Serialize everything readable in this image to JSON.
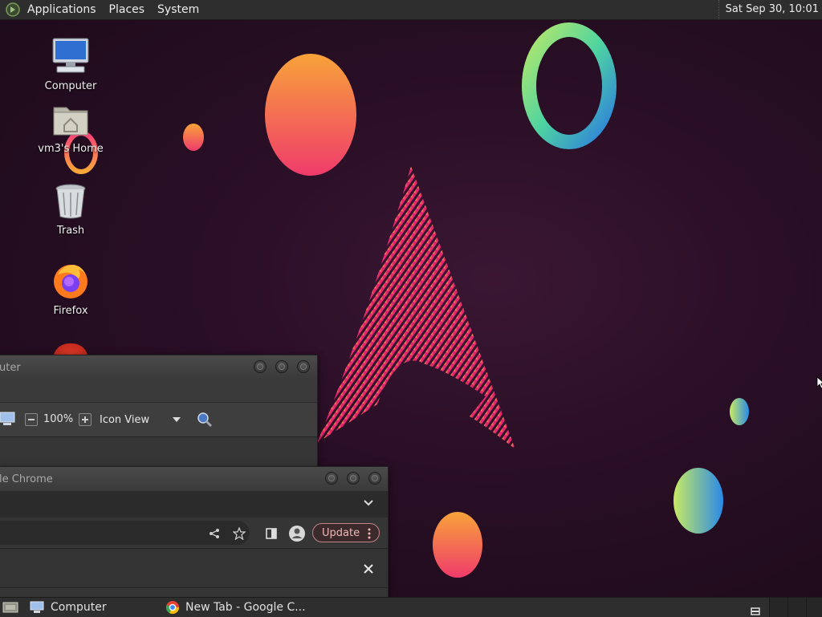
{
  "top_panel": {
    "menus": [
      "Applications",
      "Places",
      "System"
    ],
    "clock": "Sat Sep 30, 10:01"
  },
  "desktop_icons": [
    {
      "label": "Computer",
      "icon": "computer-icon"
    },
    {
      "label": "vm3's Home",
      "icon": "home-folder-icon"
    },
    {
      "label": "Trash",
      "icon": "trash-icon"
    },
    {
      "label": "Firefox",
      "icon": "firefox-icon"
    }
  ],
  "file_manager": {
    "title": "uter",
    "zoom": "100%",
    "view_mode": "Icon View"
  },
  "chrome": {
    "title": "le Chrome",
    "update_label": "Update"
  },
  "taskbar": {
    "items": [
      {
        "label": "Computer",
        "icon": "computer-icon"
      },
      {
        "label": "New Tab - Google C...",
        "icon": "chrome-icon"
      }
    ]
  },
  "colors": {
    "panel": "#2e2e2e",
    "desktop_bg": "#2a0f26",
    "accent_pink": "#e8246e",
    "accent_orange": "#f7a53b"
  }
}
